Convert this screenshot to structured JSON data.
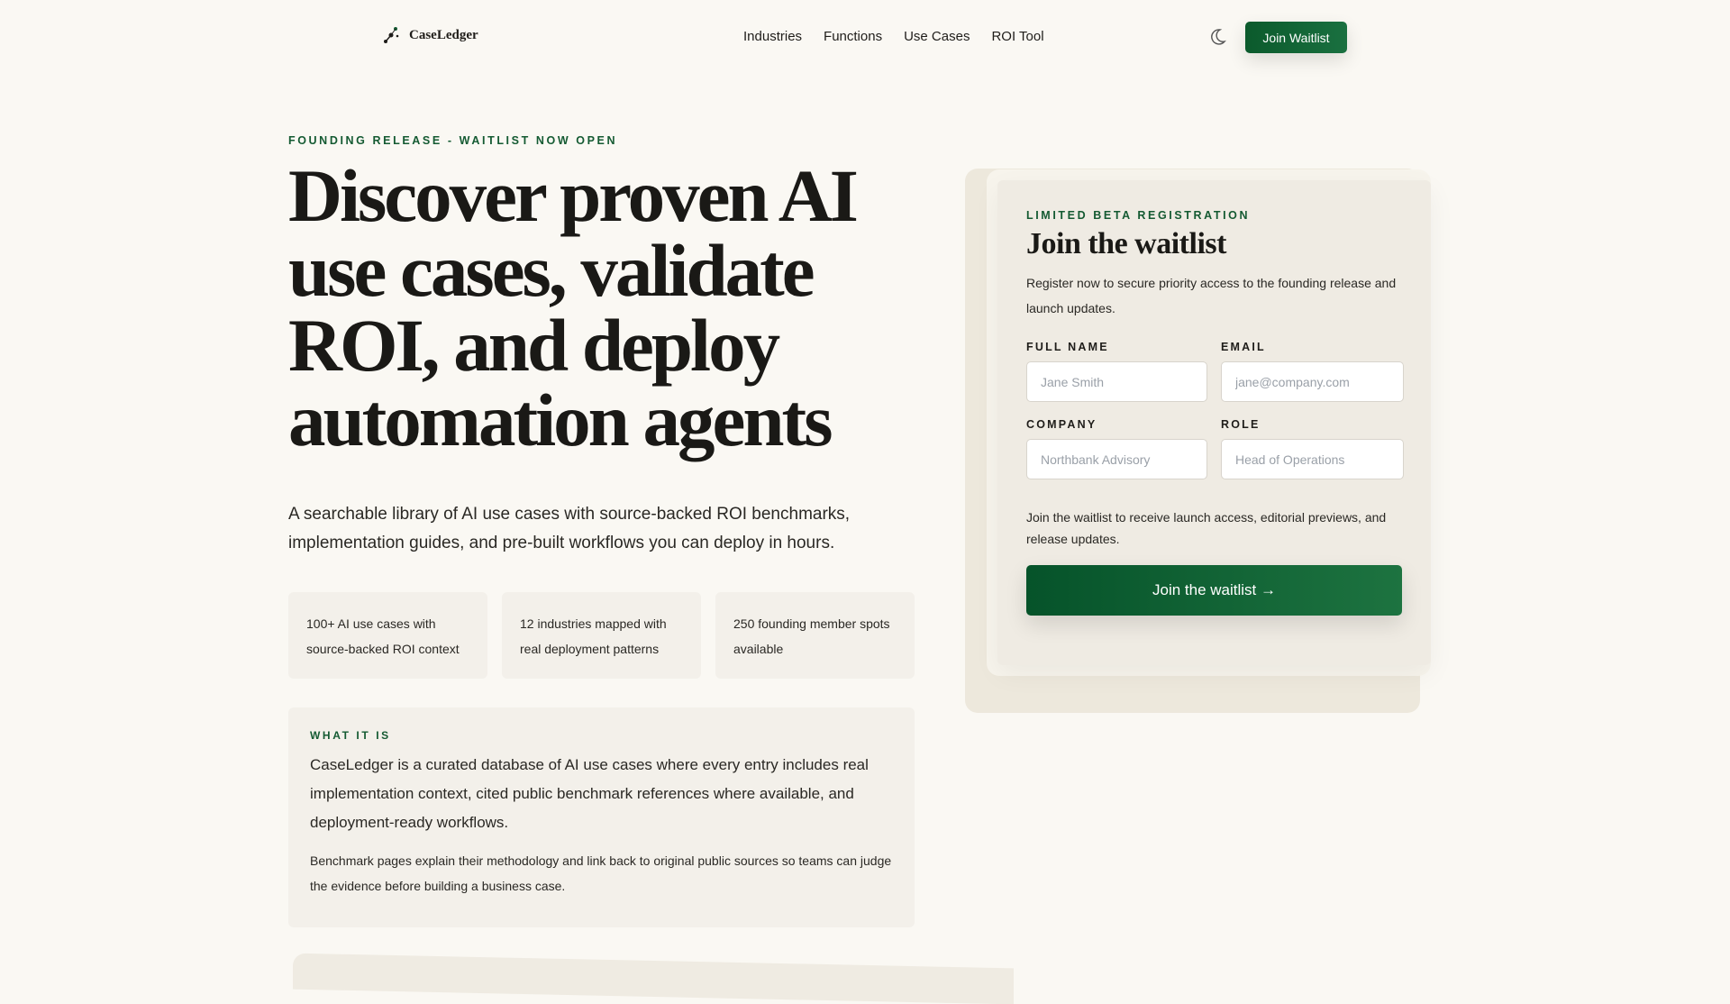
{
  "nav": {
    "brand": "CaseLedger",
    "links": [
      "Industries",
      "Functions",
      "Use Cases",
      "ROI Tool"
    ],
    "cta": "Join Waitlist"
  },
  "hero": {
    "eyebrow": "FOUNDING RELEASE - WAITLIST NOW OPEN",
    "title": "Discover proven AI use cases, validate ROI, and deploy automation agents",
    "subtitle": "A searchable library of AI use cases with source-backed ROI benchmarks, implementation guides, and pre-built workflows you can deploy in hours.",
    "stats": [
      "100+ AI use cases with source-backed ROI context",
      "12 industries mapped with real deployment patterns",
      "250 founding member spots available"
    ]
  },
  "what": {
    "eyebrow": "WHAT IT IS",
    "main": "CaseLedger is a curated database of AI use cases where every entry includes real implementation context, cited public benchmark references where available, and deployment-ready workflows.",
    "note": "Benchmark pages explain their methodology and link back to original public sources so teams can judge the evidence before building a business case."
  },
  "form": {
    "eyebrow": "LIMITED BETA REGISTRATION",
    "title": "Join the waitlist",
    "description": "Register now to secure priority access to the founding release and launch updates.",
    "fields": [
      {
        "label": "FULL NAME",
        "placeholder": "Jane Smith"
      },
      {
        "label": "EMAIL",
        "placeholder": "jane@company.com"
      },
      {
        "label": "COMPANY",
        "placeholder": "Northbank Advisory"
      },
      {
        "label": "ROLE",
        "placeholder": "Head of Operations"
      }
    ],
    "note": "Join the waitlist to receive launch access, editorial previews, and release updates.",
    "submit": "Join the waitlist →"
  },
  "colors": {
    "accent": "#0b5a2c",
    "background": "#faf8f3",
    "panel": "#f3f0ea"
  }
}
